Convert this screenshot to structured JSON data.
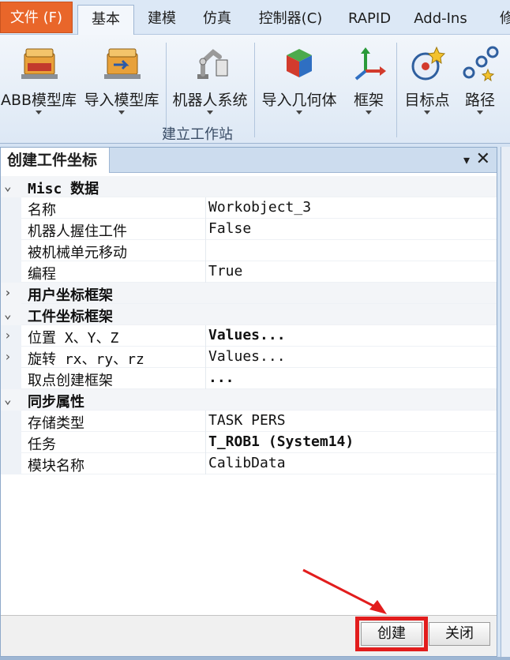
{
  "menu": {
    "tabs": [
      {
        "label": "文件 (F)"
      },
      {
        "label": "基本"
      },
      {
        "label": "建模"
      },
      {
        "label": "仿真"
      },
      {
        "label": "控制器(C)"
      },
      {
        "label": "RAPID"
      },
      {
        "label": "Add-Ins"
      },
      {
        "label": "修"
      }
    ]
  },
  "ribbon": {
    "group_label": "建立工作站",
    "buttons": [
      {
        "label": "ABB模型库",
        "icon": "model-library-icon"
      },
      {
        "label": "导入模型库",
        "icon": "import-library-icon"
      },
      {
        "label": "机器人系统",
        "icon": "robot-system-icon"
      },
      {
        "label": "导入几何体",
        "icon": "import-geometry-icon"
      },
      {
        "label": "框架",
        "icon": "frame-icon"
      },
      {
        "label": "目标点",
        "icon": "target-icon"
      },
      {
        "label": "路径",
        "icon": "path-icon"
      }
    ]
  },
  "panel": {
    "title": "创建工件坐标",
    "pin_glyph": "▾",
    "close_glyph": "✕",
    "rows": [
      {
        "type": "cat",
        "name": "Misc 数据"
      },
      {
        "name": "名称",
        "value": "Workobject_3"
      },
      {
        "name": "机器人握住工件",
        "value": "False"
      },
      {
        "name": "被机械单元移动",
        "value": ""
      },
      {
        "name": "编程",
        "value": "True"
      },
      {
        "type": "cat",
        "name": "用户坐标框架"
      },
      {
        "type": "cat",
        "name": "工件坐标框架"
      },
      {
        "name": "位置 X、Y、Z",
        "value": "Values..."
      },
      {
        "name": "旋转 rx、ry、rz",
        "value": "Values..."
      },
      {
        "name": "取点创建框架",
        "value": "..."
      },
      {
        "type": "cat",
        "name": "同步属性"
      },
      {
        "name": "存储类型",
        "value": "TASK PERS"
      },
      {
        "name": "任务",
        "value": "T_ROB1 (System14)"
      },
      {
        "name": "模块名称",
        "value": "CalibData"
      }
    ],
    "buttons": {
      "create": "创建",
      "close": "关闭"
    }
  },
  "colors": {
    "file_tab": "#e9662a",
    "highlight": "#e21d1d"
  }
}
